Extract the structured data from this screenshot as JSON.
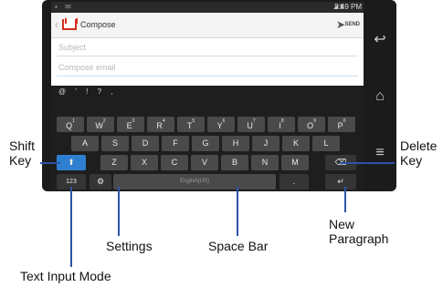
{
  "status_bar": {
    "time": "5:49 PM"
  },
  "app_bar": {
    "title": "Compose",
    "send_label": "SEND"
  },
  "fields": [
    {
      "placeholder": "Subject"
    },
    {
      "placeholder": "Compose email"
    }
  ],
  "suggestions": [
    "@",
    "'",
    "!",
    "?",
    ","
  ],
  "keyboard": {
    "row1": [
      {
        "key": "Q",
        "alt": "1"
      },
      {
        "key": "W",
        "alt": "2"
      },
      {
        "key": "E",
        "alt": "3"
      },
      {
        "key": "R",
        "alt": "4"
      },
      {
        "key": "T",
        "alt": "5"
      },
      {
        "key": "Y",
        "alt": "6"
      },
      {
        "key": "U",
        "alt": "7"
      },
      {
        "key": "I",
        "alt": "8"
      },
      {
        "key": "O",
        "alt": "9"
      },
      {
        "key": "P",
        "alt": "0"
      }
    ],
    "row2": [
      "A",
      "S",
      "D",
      "F",
      "G",
      "H",
      "J",
      "K",
      "L"
    ],
    "row3": [
      "Z",
      "X",
      "C",
      "V",
      "B",
      "N",
      "M"
    ],
    "mode_key": "123",
    "space_label": "English(US)"
  },
  "callouts": {
    "shift": "Shift\nKey",
    "delete": "Delete\nKey",
    "settings": "Settings",
    "space": "Space Bar",
    "new_paragraph": "New\nParagraph",
    "input_mode": "Text Input Mode"
  },
  "colors": {
    "callout_line": "#2a55a6",
    "key": "#4a4a4a",
    "accent": "#2e8bd6"
  }
}
